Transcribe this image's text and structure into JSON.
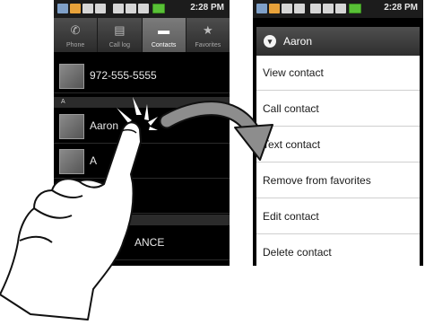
{
  "status_bar": {
    "time": "2:28 PM"
  },
  "tabs": [
    {
      "label": "Phone",
      "icon": "phone-icon"
    },
    {
      "label": "Call log",
      "icon": "call-log-icon"
    },
    {
      "label": "Contacts",
      "icon": "contacts-icon",
      "active": true
    },
    {
      "label": "Favorites",
      "icon": "star-icon"
    }
  ],
  "contacts": {
    "first_row": "972-555-5555",
    "section_a": "A",
    "aaron": "Aaron",
    "row_partial_1": "A",
    "row_partial_2": "ANCE"
  },
  "context_menu": {
    "title": "Aaron",
    "items": [
      "View contact",
      "Call contact",
      "Text contact",
      "Remove from favorites",
      "Edit contact",
      "Delete contact"
    ]
  },
  "colors": {
    "battery": "#58c136",
    "menu_background": "#ffffff",
    "tab_active": "#6a6a6a"
  }
}
